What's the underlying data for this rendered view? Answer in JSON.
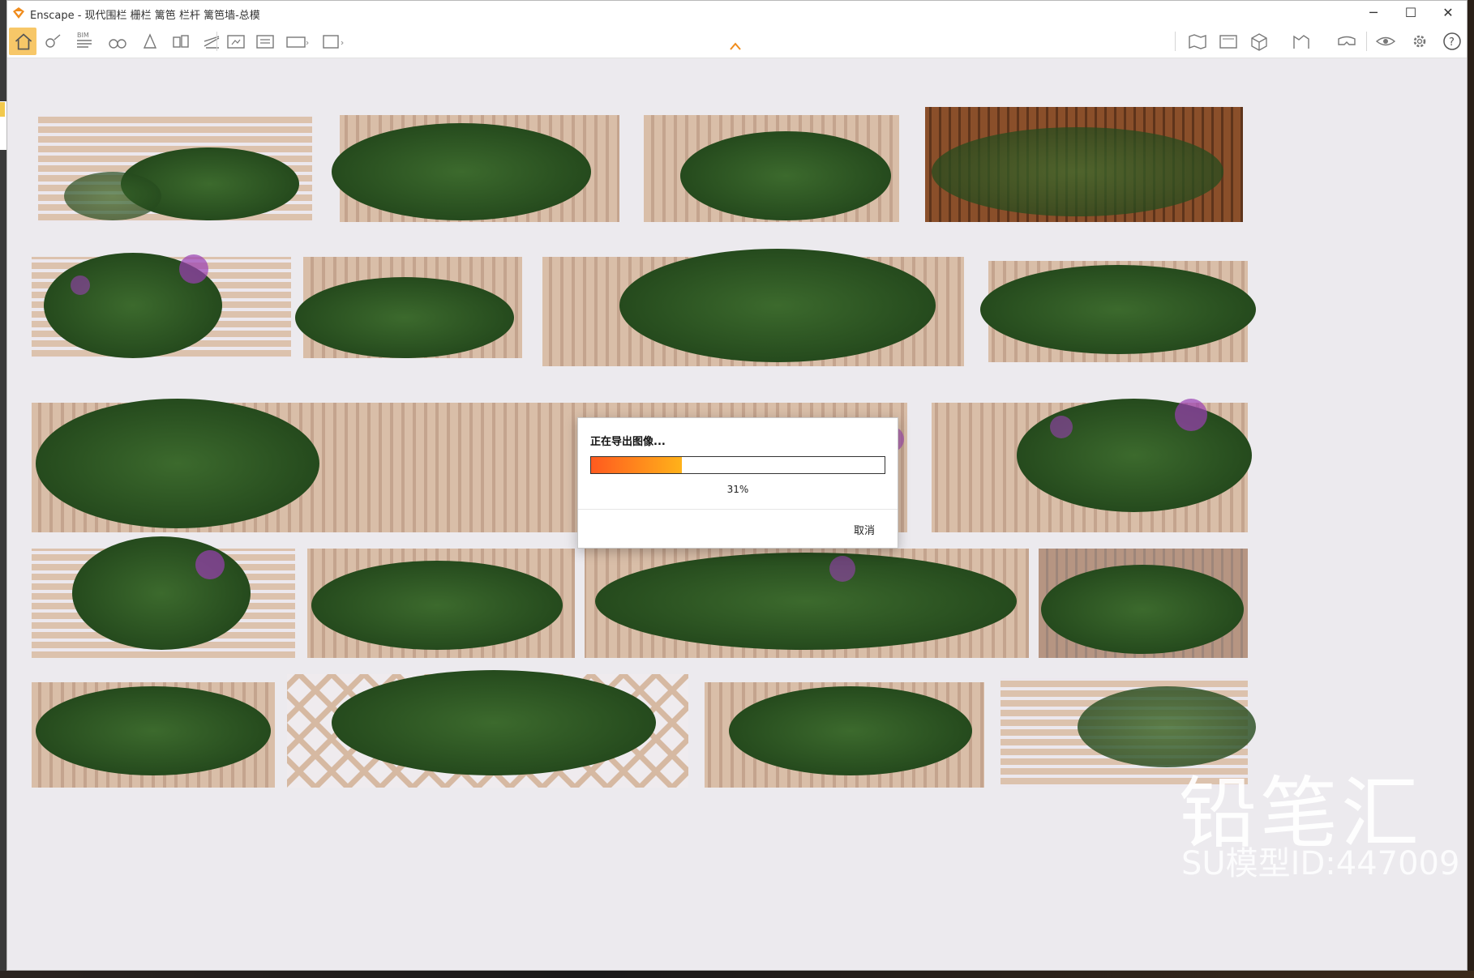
{
  "window": {
    "title": "Enscape - 现代围栏 栅栏 篱笆 栏杆 篱笆墙-总模",
    "minimize": "─",
    "maximize": "☐",
    "close": "✕"
  },
  "toolbar": {
    "bim_label": "BIM",
    "help_label": "?",
    "icons": [
      "home-icon",
      "visual-settings-icon",
      "bim-icon",
      "binoculars-icon",
      "capture-icon",
      "asset-library-icon",
      "material-editor-icon",
      "screenshot-icon",
      "batch-render-icon",
      "panorama-icon",
      "export-icon",
      "map-icon",
      "web-standalone-icon",
      "view-cube-icon",
      "video-editor-icon",
      "vr-headset-icon",
      "eye-icon",
      "settings-icon",
      "help-icon"
    ]
  },
  "export_dialog": {
    "title": "正在导出图像...",
    "progress": 0.31,
    "progress_label": "31%",
    "cancel_label": "取消"
  },
  "watermark": {
    "brand": "铅笔汇",
    "model_id": "SU模型ID:447009"
  },
  "colors": {
    "progress_start": "#ff5a1f",
    "progress_end": "#ffb21a",
    "home_button_bg": "#f7c768",
    "enscape_orange": "#f08c1c"
  }
}
